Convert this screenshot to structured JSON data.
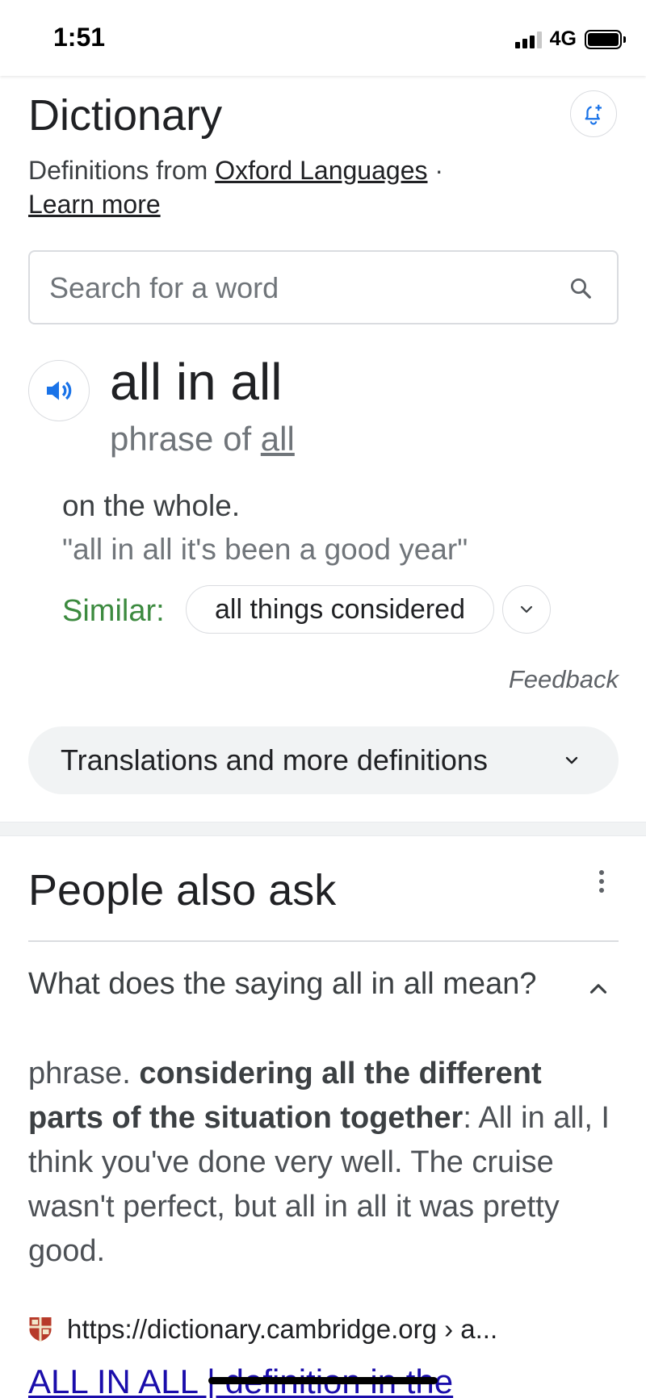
{
  "status_bar": {
    "time": "1:51",
    "network": "4G"
  },
  "dictionary": {
    "title": "Dictionary",
    "source_prefix": "Definitions from",
    "source_name": "Oxford Languages",
    "separator": "·",
    "learn_more": "Learn more"
  },
  "search": {
    "placeholder": "Search for a word"
  },
  "entry": {
    "headword": "all in all",
    "phrase_prefix": "phrase of",
    "phrase_link": "all",
    "definition": "on the whole.",
    "example": "\"all in all it's been a good year\"",
    "similar_label": "Similar:",
    "similar_chip": "all things considered"
  },
  "feedback": "Feedback",
  "translations_button": "Translations and more definitions",
  "people_also_ask": {
    "title": "People also ask",
    "question": "What does the saying all in all mean?",
    "answer_prefix": "phrase. ",
    "answer_bold": "considering all the different parts of the situation together",
    "answer_rest": ": All in all, I think you've done very well. The cruise wasn't perfect, but all in all it was pretty good.",
    "source_url": "https://dictionary.cambridge.org › a...",
    "result_title": "ALL IN ALL | definition in the"
  },
  "colors": {
    "similar_green": "#3c8a3f",
    "link_blue": "#1a0dab",
    "icon_blue": "#1a73e8"
  }
}
